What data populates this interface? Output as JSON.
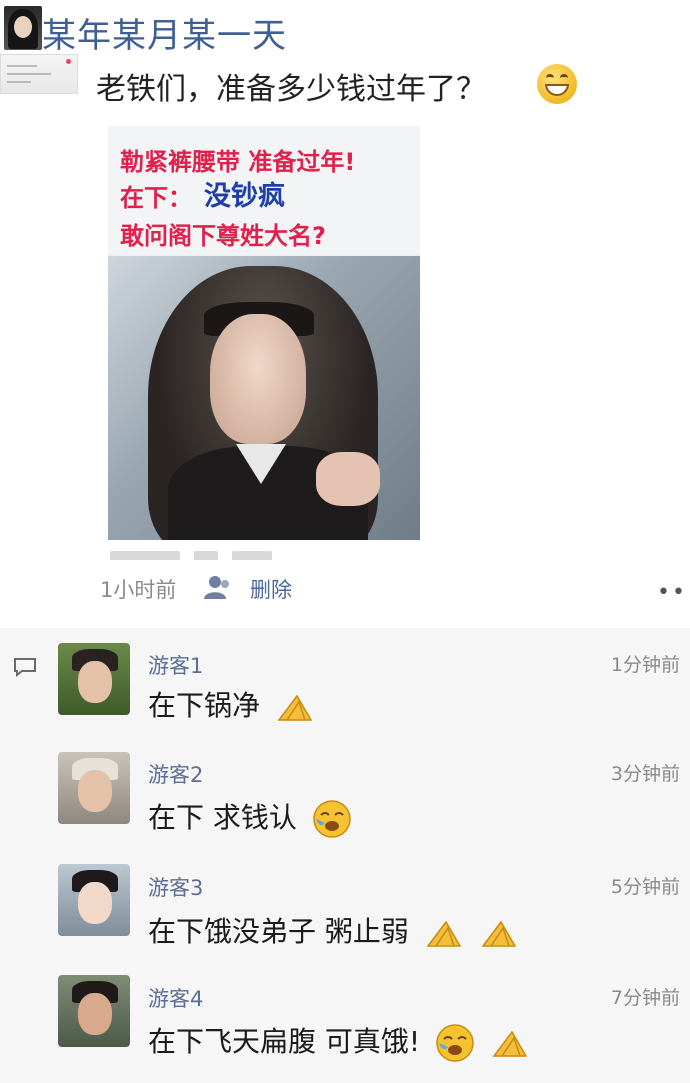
{
  "post": {
    "title": "某年某月某一天",
    "text": "老铁们，准备多少钱过年了？",
    "emoji": "grin-emoji",
    "time": "1小时前",
    "delete_label": "删除",
    "more_label": "••"
  },
  "meme": {
    "line1": "勒紧裤腰带 准备过年!",
    "line2_prefix": "在下：",
    "line2_name": "没钞疯",
    "line3": "敢问阁下尊姓大名?"
  },
  "comments": [
    {
      "name": "游客1",
      "time": "1分钟前",
      "text": "在下锅净",
      "emojis": [
        "pray-emoji"
      ]
    },
    {
      "name": "游客2",
      "time": "3分钟前",
      "text": "在下 求钱认",
      "emojis": [
        "cry-emoji"
      ]
    },
    {
      "name": "游客3",
      "time": "5分钟前",
      "text": "在下饿没弟子 粥止弱",
      "emojis": [
        "pray-emoji",
        "pray-emoji"
      ]
    },
    {
      "name": "游客4",
      "time": "7分钟前",
      "text": "在下飞天扁腹 可真饿!",
      "emojis": [
        "cry-emoji",
        "pray-emoji"
      ]
    }
  ],
  "colors": {
    "title": "#3d5f95",
    "meme_red": "#e0214c",
    "meme_blue": "#1d3fa7",
    "link": "#4a6aa0",
    "comment_bg": "#f6f6f6"
  }
}
